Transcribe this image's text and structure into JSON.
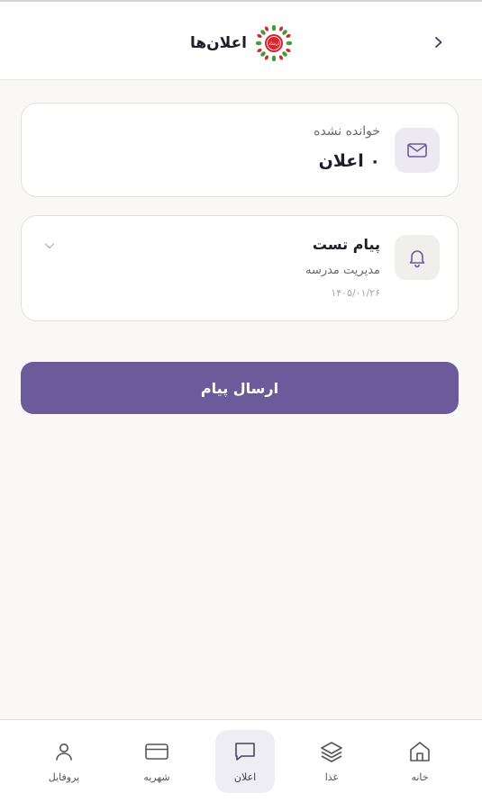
{
  "header": {
    "title": "اعلان‌ها",
    "back_icon": "chevron-right-icon",
    "logo_text": "ارشاد"
  },
  "unread_card": {
    "label": "خوانده نشده",
    "count": "۰ اعلان",
    "icon": "mail-icon"
  },
  "notifications": [
    {
      "title": "پیام تست",
      "sender": "مدیریت مدرسه",
      "date": "۱۴۰۵/۰۱/۲۶",
      "icon": "bell-icon",
      "expand_icon": "chevron-down-icon"
    }
  ],
  "send_button": {
    "label": "ارسال پیام"
  },
  "bottom_nav": {
    "items": [
      {
        "label": "پروفایل",
        "icon": "user-icon",
        "active": false
      },
      {
        "label": "شهریه",
        "icon": "credit-card-icon",
        "active": false
      },
      {
        "label": "اعلان",
        "icon": "message-icon",
        "active": true
      },
      {
        "label": "غذا",
        "icon": "layers-icon",
        "active": false
      },
      {
        "label": "خانه",
        "icon": "home-icon",
        "active": false
      }
    ]
  },
  "colors": {
    "primary": "#6c5b9b",
    "background": "#f9f8f6",
    "card": "#ffffff",
    "logo_red": "#d6262e",
    "logo_green": "#3f9c3a"
  }
}
